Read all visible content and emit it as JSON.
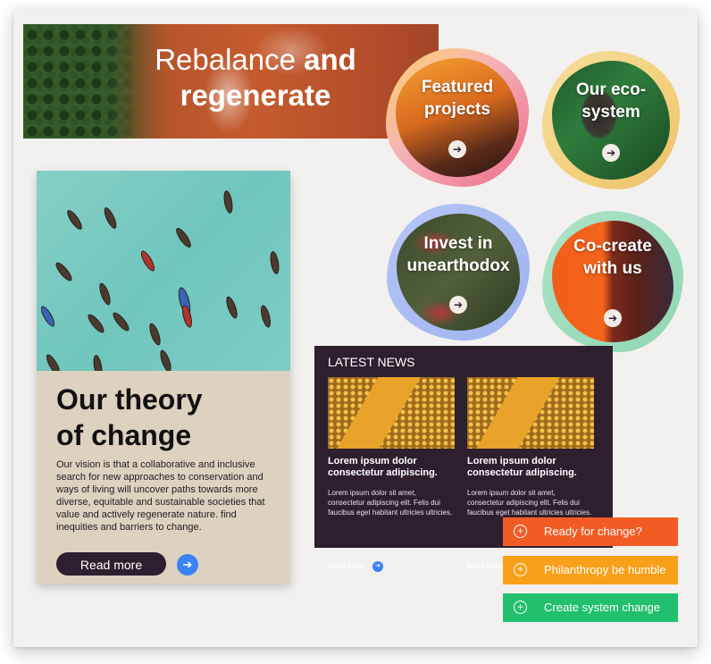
{
  "hero": {
    "line1_light": "Rebalance",
    "line1_bold": "and",
    "line2": "regenerate"
  },
  "blobs": [
    {
      "label": "Featured projects",
      "icon": "arrow-right-icon"
    },
    {
      "label": "Our eco-system",
      "icon": "arrow-right-icon"
    },
    {
      "label": "Invest in unearthodox",
      "icon": "arrow-right-icon"
    },
    {
      "label": "Co-create with us",
      "icon": "arrow-right-icon"
    }
  ],
  "theory": {
    "title_line1": "Our theory",
    "title_line2": "of change",
    "body": "Our vision is that a collaborative and inclusive search for new approaches to conservation and ways of living will uncover paths towards more diverse, equitable and sustainable societies that value and actively regenerate nature. find inequities and barriers to change.",
    "button": "Read more"
  },
  "news": {
    "header": "LATEST NEWS",
    "items": [
      {
        "title": "Lorem ipsum dolor consectetur adipiscing.",
        "body": "Lorem ipsum dolor sit amet, consectetur adipiscing elit. Felis dui faucibus eget habitant ultricies ultricies.",
        "more": "Read more"
      },
      {
        "title": "Lorem ipsum dolor consectetur adipiscing.",
        "body": "Lorem ipsum dolor sit amet, consectetur adipiscing elit. Felis dui faucibus eget habitant ultricies ultricies.",
        "more": "Read more"
      }
    ]
  },
  "ctas": [
    {
      "label": "Ready for change?",
      "color": "#f25c24"
    },
    {
      "label": "Philanthropy be humble",
      "color": "#f8a01a"
    },
    {
      "label": "Create system change",
      "color": "#22c06e"
    }
  ],
  "colors": {
    "dark": "#2d1f2d",
    "accent_blue": "#3b82f6",
    "card_beige": "#ddd1c0"
  }
}
